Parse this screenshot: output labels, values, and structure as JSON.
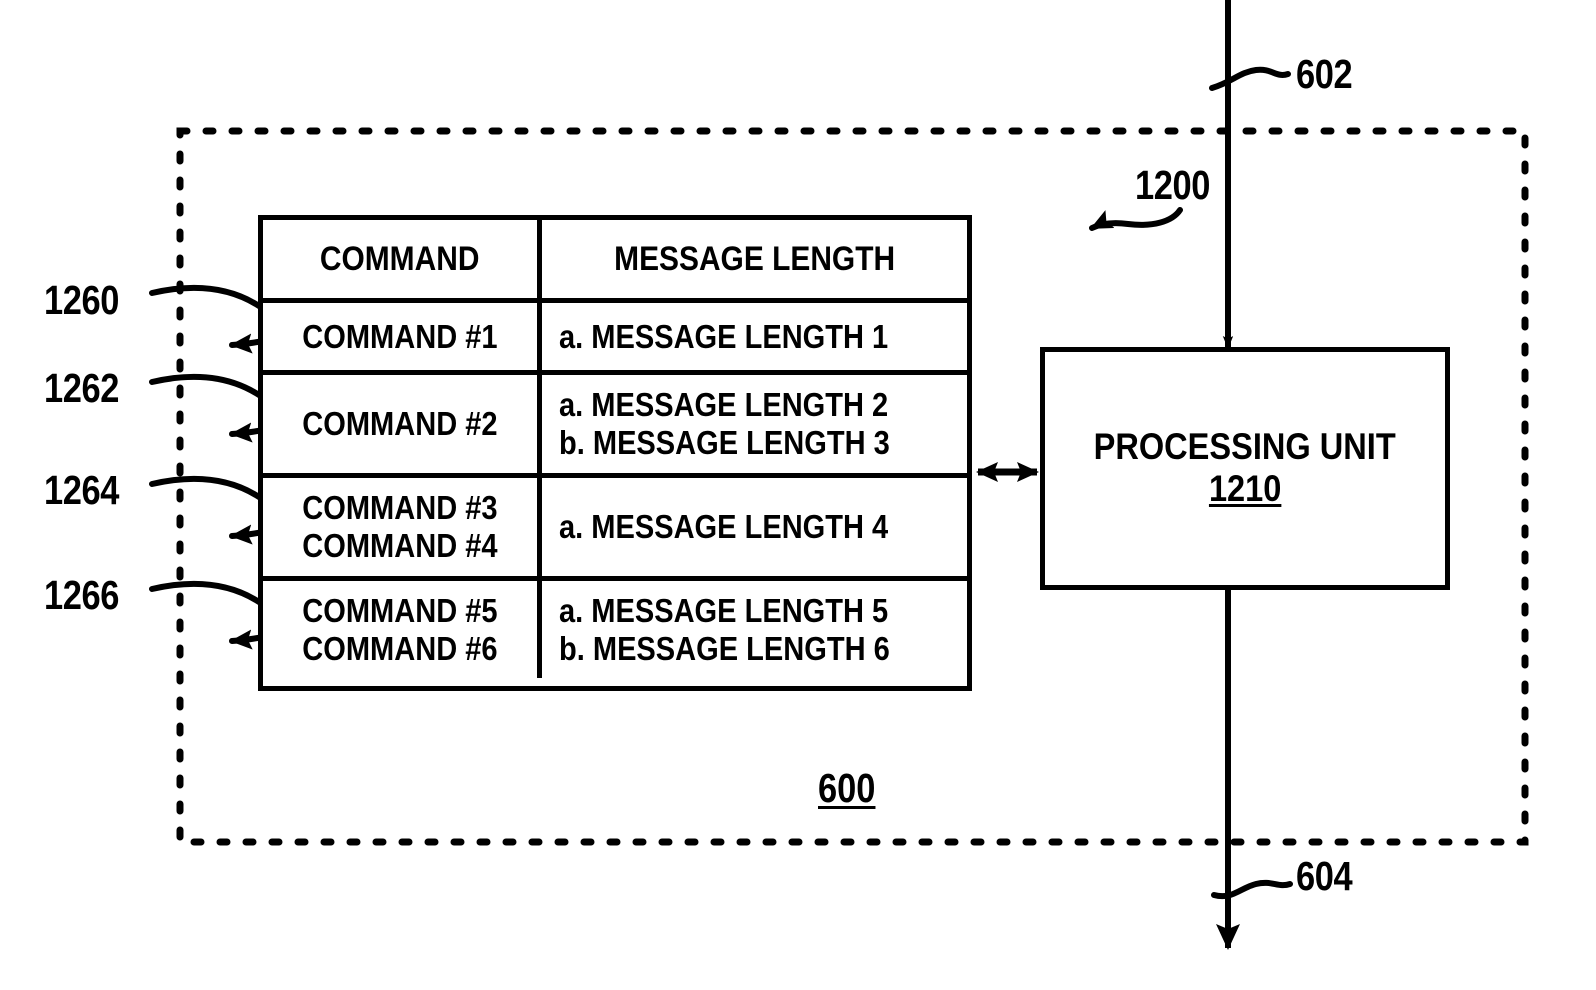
{
  "figure": {
    "enclosure_label": "600",
    "table_label": "1200",
    "input_line_label": "602",
    "output_line_label": "604"
  },
  "table": {
    "headers": [
      "COMMAND",
      "MESSAGE LENGTH"
    ],
    "rows": [
      {
        "ref": "1260",
        "commands": [
          "COMMAND #1"
        ],
        "lengths": [
          "a. MESSAGE LENGTH 1"
        ]
      },
      {
        "ref": "1262",
        "commands": [
          "COMMAND #2"
        ],
        "lengths": [
          "a. MESSAGE LENGTH 2",
          "b. MESSAGE LENGTH 3"
        ]
      },
      {
        "ref": "1264",
        "commands": [
          "COMMAND #3",
          "COMMAND #4"
        ],
        "lengths": [
          "a. MESSAGE LENGTH 4"
        ]
      },
      {
        "ref": "1266",
        "commands": [
          "COMMAND #5",
          "COMMAND #6"
        ],
        "lengths": [
          "a. MESSAGE LENGTH 5",
          "b. MESSAGE LENGTH 6"
        ]
      }
    ]
  },
  "processing_unit": {
    "title": "PROCESSING UNIT",
    "number": "1210"
  },
  "colors": {
    "stroke": "#000000",
    "background": "#ffffff"
  }
}
